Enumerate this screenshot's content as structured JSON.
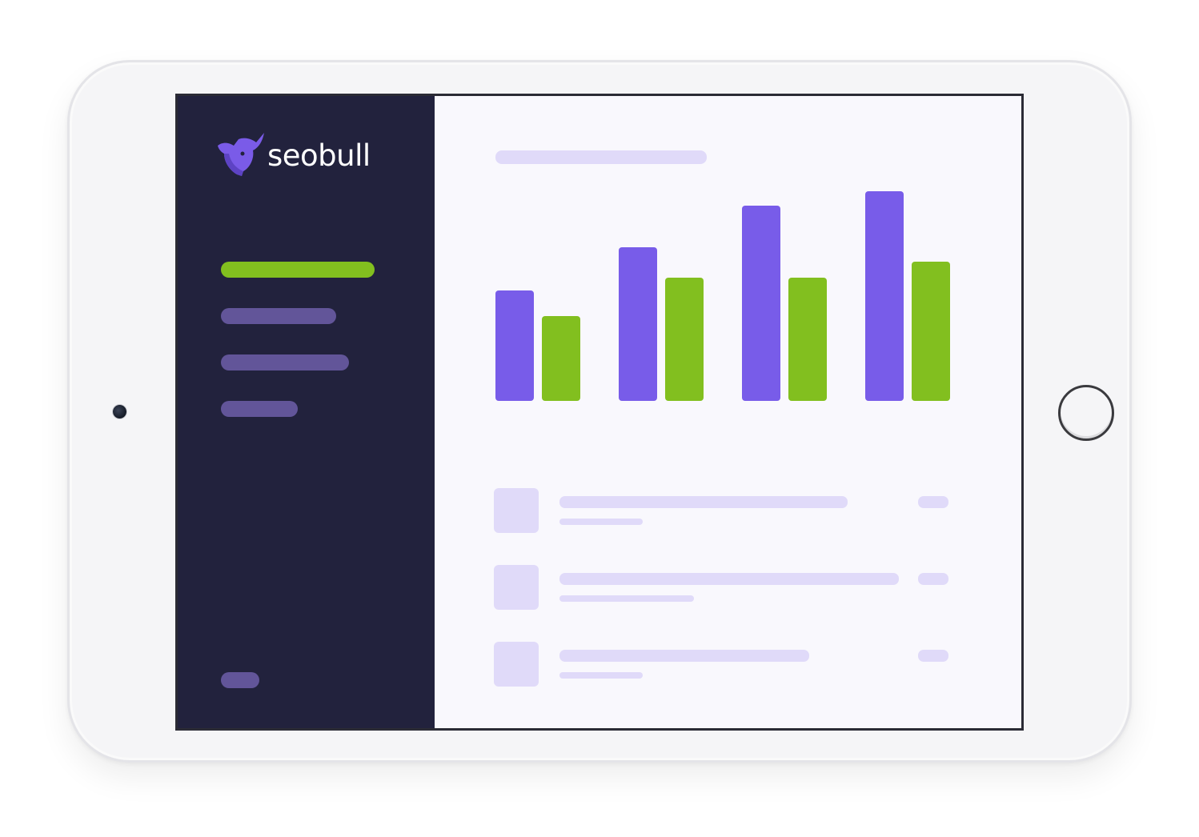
{
  "brand": {
    "name": "seobull",
    "mark_color": "#7a5be8",
    "mark_dark": "#5d43c4"
  },
  "colors": {
    "sidebar_bg": "#22223d",
    "content_bg": "#f9f8fd",
    "placeholder": "#e0daf9",
    "accent_green": "#82bf1f",
    "accent_purple": "#785ce9",
    "nav_muted": "#625599"
  },
  "sidebar": {
    "items": [
      {
        "id": "nav-1",
        "state": "active",
        "color": "#82bf1f"
      },
      {
        "id": "nav-2",
        "state": "inactive",
        "color": "#625599"
      },
      {
        "id": "nav-3",
        "state": "inactive",
        "color": "#625599"
      },
      {
        "id": "nav-4",
        "state": "inactive",
        "color": "#625599"
      }
    ],
    "footer_item": {
      "id": "nav-footer",
      "color": "#625599"
    }
  },
  "chart_data": {
    "type": "bar",
    "categories": [
      "",
      "",
      "",
      ""
    ],
    "series": [
      {
        "color": "#785ce9",
        "values": [
          138,
          192,
          244,
          262
        ]
      },
      {
        "color": "#82bf1f",
        "values": [
          106,
          154,
          154,
          174
        ]
      }
    ],
    "ylim": [
      0,
      280
    ],
    "title": "",
    "xlabel": "",
    "ylabel": "",
    "grid": false
  },
  "list": {
    "rows": [
      {
        "id": "row-1"
      },
      {
        "id": "row-2"
      },
      {
        "id": "row-3"
      }
    ]
  }
}
